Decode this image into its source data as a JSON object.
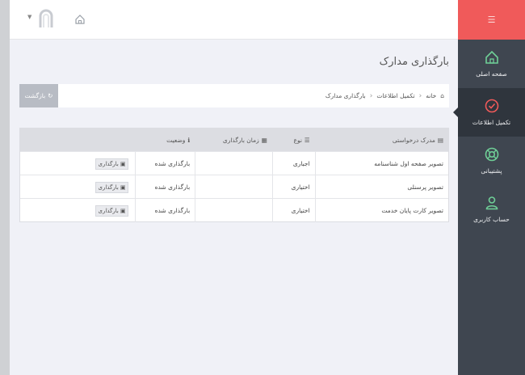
{
  "header": {
    "home_icon": "home-icon",
    "avatar_icon": "user-avatar-icon"
  },
  "sidebar": {
    "menu_icon": "hamburger-icon",
    "items": [
      {
        "label": "صفحه اصلی",
        "icon": "home-icon",
        "active": false
      },
      {
        "label": "تکمیل اطلاعات",
        "icon": "check-circle-icon",
        "active": true
      },
      {
        "label": "پشتیبانی",
        "icon": "support-icon",
        "active": false
      },
      {
        "label": "حساب کاربری",
        "icon": "user-icon",
        "active": false
      }
    ]
  },
  "page": {
    "title": "بارگذاری مدارک"
  },
  "breadcrumb": {
    "items": [
      "خانه",
      "تکمیل اطلاعات",
      "بارگذاری مدارک"
    ],
    "back_label": "بازگشت"
  },
  "table": {
    "headers": [
      "مدرک درخواستی",
      "نوع",
      "زمان بارگذاری",
      "وضعیت",
      ""
    ],
    "rows": [
      {
        "doc": "تصویر صفحه اول شناسنامه",
        "type": "اجباری",
        "time": "",
        "status": "بارگذاری شده",
        "action": "بارگذاری"
      },
      {
        "doc": "تصویر پرسنلی",
        "type": "اختیاری",
        "time": "",
        "status": "بارگذاری شده",
        "action": "بارگذاری"
      },
      {
        "doc": "تصویر کارت پایان خدمت",
        "type": "اختیاری",
        "time": "",
        "status": "بارگذاری شده",
        "action": "بارگذاری"
      }
    ]
  },
  "colors": {
    "accent": "#f05a5a",
    "sidebar": "#3f4650",
    "sidebar_active": "#2f353d",
    "icon_green": "#6fcf97",
    "icon_red": "#f05a5a"
  }
}
